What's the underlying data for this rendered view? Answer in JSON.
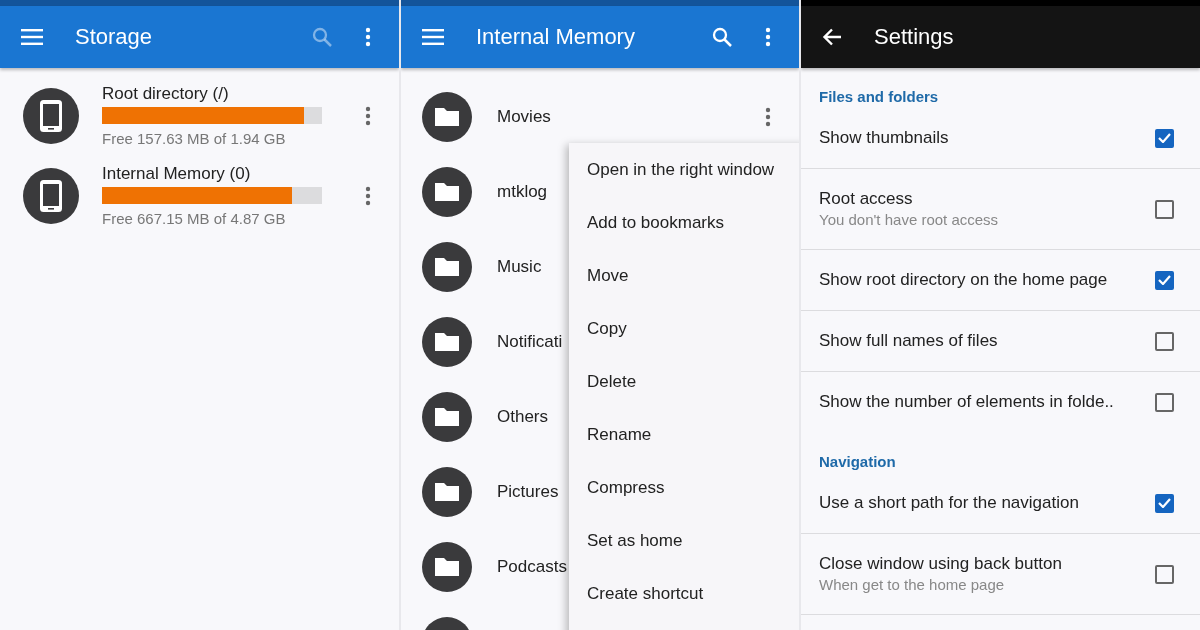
{
  "panels": [
    {
      "kind": "storage",
      "toolbar": {
        "back_button": false,
        "title": "Storage",
        "search_disabled": true
      },
      "volumes": [
        {
          "name": "Root directory (/)",
          "level": 0.92,
          "usage": "Free 157.63 MB of 1.94 GB"
        },
        {
          "name": "Internal Memory (0)",
          "level": 0.865,
          "usage": "Free 667.15 MB of 4.87 GB"
        }
      ]
    },
    {
      "kind": "folders",
      "toolbar": {
        "back_button": false,
        "title": "Internal Memory",
        "search_disabled": false
      },
      "folders": [
        {
          "kind": "folder",
          "name": "Movies",
          "more": true
        },
        {
          "kind": "folder",
          "name": "mtklog"
        },
        {
          "kind": "folder",
          "name": "Music"
        },
        {
          "kind": "folder",
          "name": "Notificati"
        },
        {
          "kind": "folder",
          "name": "Others"
        },
        {
          "kind": "folder",
          "name": "Pictures"
        },
        {
          "kind": "folder",
          "name": "Podcasts"
        },
        {
          "kind": "folder"
        }
      ],
      "context_menu": {
        "items": [
          "Open in the right window",
          "Add to bookmarks",
          "Move",
          "Copy",
          "Delete",
          "Rename",
          "Compress",
          "Set as home",
          "Create shortcut"
        ]
      }
    },
    {
      "kind": "settings",
      "toolbar": {
        "back_button": true,
        "title": "Settings"
      },
      "sections": [
        {
          "title": "Files and folders",
          "options": [
            {
              "title": "Show thumbnails",
              "checked": true
            },
            {
              "title": "Root access",
              "summary": "You don't have root access",
              "checked": false
            },
            {
              "title": "Show root directory on the home page",
              "checked": true
            },
            {
              "title": "Show full names of files",
              "checked": false
            },
            {
              "title": "Show the number of elements in folde..",
              "checked": false
            }
          ]
        },
        {
          "title": "Navigation",
          "options": [
            {
              "title": "Use a short path for the navigation",
              "checked": true
            },
            {
              "title": "Close window using back button",
              "summary": "When get to the home page",
              "checked": false
            }
          ]
        }
      ]
    }
  ]
}
